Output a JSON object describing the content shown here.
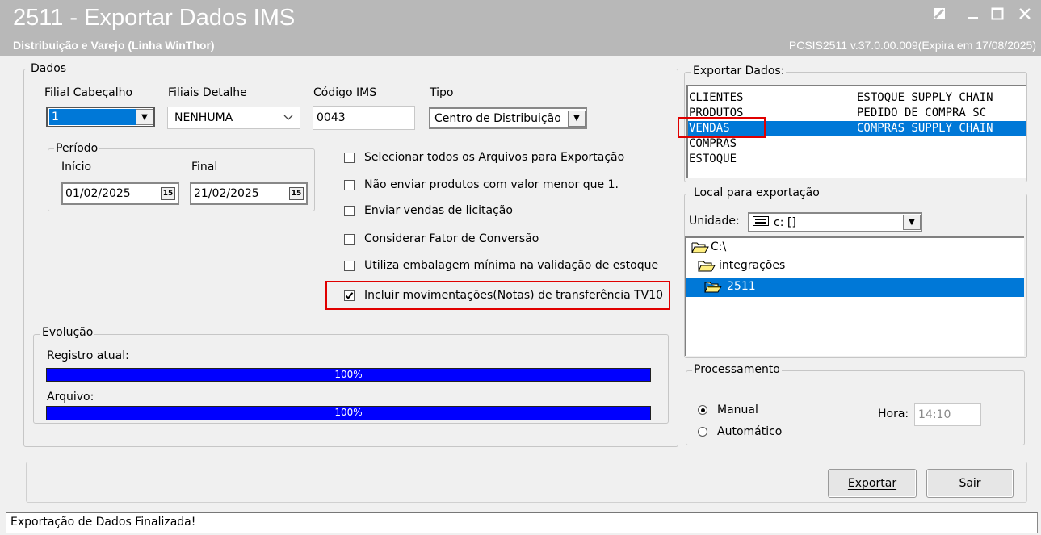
{
  "window": {
    "title": "2511 - Exportar Dados IMS",
    "subtitle": "Distribuição e Varejo (Linha WinThor)",
    "version": "PCSIS2511  v.37.0.00.009(Expira em 17/08/2025)"
  },
  "dados": {
    "group_label": "Dados",
    "filial_cabecalho_label": "Filial Cabeçalho",
    "filial_cabecalho_value": "1",
    "filiais_detalhe_label": "Filiais Detalhe",
    "filiais_detalhe_value": "NENHUMA",
    "codigo_ims_label": "Código IMS",
    "codigo_ims_value": "0043",
    "tipo_label": "Tipo",
    "tipo_value": "Centro de Distribuição"
  },
  "periodo": {
    "group_label": "Período",
    "inicio_label": "Início",
    "inicio_value": "01/02/2025",
    "final_label": "Final",
    "final_value": "21/02/2025",
    "calendar_glyph": "15"
  },
  "options": [
    {
      "label": "Selecionar todos os Arquivos para Exportação",
      "checked": false
    },
    {
      "label": "Não enviar produtos com valor menor que 1.",
      "checked": false
    },
    {
      "label": "Enviar vendas de licitação",
      "checked": false
    },
    {
      "label": "Considerar Fator de Conversão",
      "checked": false
    },
    {
      "label": "Utiliza embalagem mínima na validação de estoque",
      "checked": false
    },
    {
      "label": "Incluir movimentações(Notas) de transferência TV10",
      "checked": true
    }
  ],
  "evolucao": {
    "group_label": "Evolução",
    "registro_label": "Registro atual:",
    "registro_progress": "100%",
    "registro_fraction": 1.0,
    "arquivo_label": "Arquivo:",
    "arquivo_progress": "100%",
    "arquivo_fraction": 1.0
  },
  "exportar": {
    "group_label": "Exportar Dados:",
    "col1": [
      "CLIENTES",
      "PRODUTOS",
      "VENDAS",
      "COMPRAS",
      "ESTOQUE"
    ],
    "col2": [
      "ESTOQUE SUPPLY CHAIN",
      "PEDIDO DE COMPRA SC",
      "COMPRAS SUPPLY CHAIN"
    ],
    "selected_row": 2
  },
  "local": {
    "group_label": "Local para exportação",
    "unidade_label": "Unidade:",
    "unidade_value": "c: []",
    "folders": [
      "C:\\",
      "integrações",
      "2511"
    ],
    "selected_folder": 2
  },
  "processamento": {
    "group_label": "Processamento",
    "manual_label": "Manual",
    "automatico_label": "Automático",
    "selected": "manual",
    "hora_label": "Hora:",
    "hora_value": "14:10"
  },
  "buttons": {
    "exportar_label": "Exportar",
    "sair_label": "Sair"
  },
  "status": {
    "text": "Exportação de Dados Finalizada!"
  },
  "colors": {
    "selection": "#0078d7",
    "progress": "#0000ff",
    "highlight": "#e00000"
  }
}
